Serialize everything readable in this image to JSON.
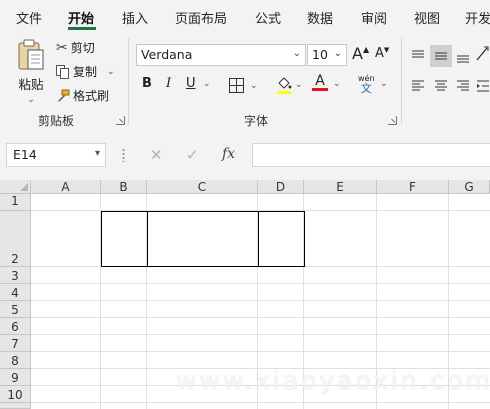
{
  "menu": {
    "tabs": [
      "文件",
      "开始",
      "插入",
      "页面布局",
      "公式",
      "数据",
      "审阅",
      "视图",
      "开发"
    ]
  },
  "clipboard": {
    "paste_label": "粘贴",
    "cut_label": "剪切",
    "copy_label": "复制",
    "painter_label": "格式刷",
    "group_label": "剪贴板"
  },
  "font": {
    "family": "Verdana",
    "size": "10",
    "grow": "A",
    "shrink": "A",
    "bold": "B",
    "italic": "I",
    "underline": "U",
    "font_color_letter": "A",
    "phonetic_top": "wén",
    "phonetic_bottom": "文",
    "group_label": "字体",
    "font_color": "#e81123"
  },
  "formula_bar": {
    "name_box": "E14",
    "cancel": "✕",
    "enter": "✓",
    "fx": "fx",
    "value": ""
  },
  "sheet": {
    "columns": [
      "A",
      "B",
      "C",
      "D",
      "E",
      "F",
      "G"
    ],
    "rows": [
      "1",
      "2",
      "3",
      "4",
      "5",
      "6",
      "7",
      "8",
      "9",
      "10"
    ]
  },
  "watermark": "www.xiaoyaoxin.com",
  "colors": {
    "accent": "#217346",
    "ribbon_bg": "#f3f3f3",
    "header_bg": "#e6e6e6"
  }
}
